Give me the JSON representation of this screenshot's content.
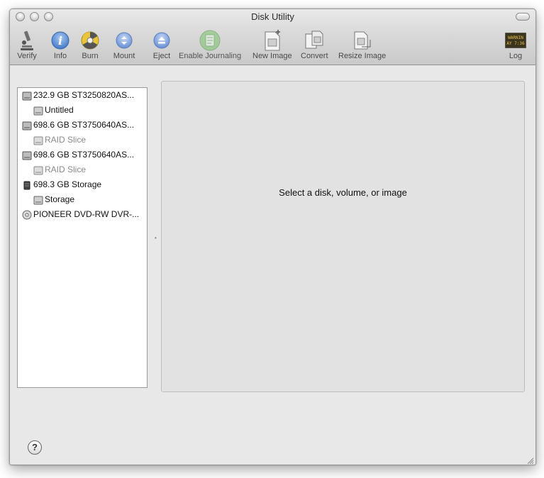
{
  "window": {
    "title": "Disk Utility"
  },
  "toolbar": {
    "items": [
      {
        "label": "Verify",
        "icon": "microscope-icon"
      },
      {
        "label": "Info",
        "icon": "info-icon"
      },
      {
        "label": "Burn",
        "icon": "burn-icon"
      },
      {
        "label": "Mount",
        "icon": "mount-icon"
      },
      {
        "label": "Eject",
        "icon": "eject-icon"
      },
      {
        "label": "Enable Journaling",
        "icon": "journaling-icon"
      },
      {
        "label": "New Image",
        "icon": "new-image-icon"
      },
      {
        "label": "Convert",
        "icon": "convert-icon"
      },
      {
        "label": "Resize Image",
        "icon": "resize-image-icon"
      },
      {
        "label": "Log",
        "icon": "log-icon",
        "icon_text": "WARNIN\nAY 7:36"
      }
    ]
  },
  "sidebar": {
    "items": [
      {
        "label": "232.9 GB ST3250820AS...",
        "level": 0,
        "icon": "hard-disk-icon",
        "dim": false
      },
      {
        "label": "Untitled",
        "level": 1,
        "icon": "volume-icon",
        "dim": false
      },
      {
        "label": "698.6 GB ST3750640AS...",
        "level": 0,
        "icon": "hard-disk-icon",
        "dim": false
      },
      {
        "label": "RAID Slice",
        "level": 1,
        "icon": "volume-icon",
        "dim": true
      },
      {
        "label": "698.6 GB ST3750640AS...",
        "level": 0,
        "icon": "hard-disk-icon",
        "dim": false
      },
      {
        "label": "RAID Slice",
        "level": 1,
        "icon": "volume-icon",
        "dim": true
      },
      {
        "label": "698.3 GB Storage",
        "level": 0,
        "icon": "raid-disk-icon",
        "dim": false
      },
      {
        "label": "Storage",
        "level": 1,
        "icon": "volume-icon",
        "dim": false
      },
      {
        "label": "PIONEER DVD-RW DVR-...",
        "level": 0,
        "icon": "optical-drive-icon",
        "dim": false
      }
    ]
  },
  "detail": {
    "message": "Select a disk, volume, or image"
  },
  "help": {
    "label": "?"
  },
  "colors": {
    "info_blue": "#5b8fd6",
    "burn_yellow": "#e8c53a",
    "journaling_green": "#7ac36a",
    "window_bg": "#e8e8e8"
  }
}
